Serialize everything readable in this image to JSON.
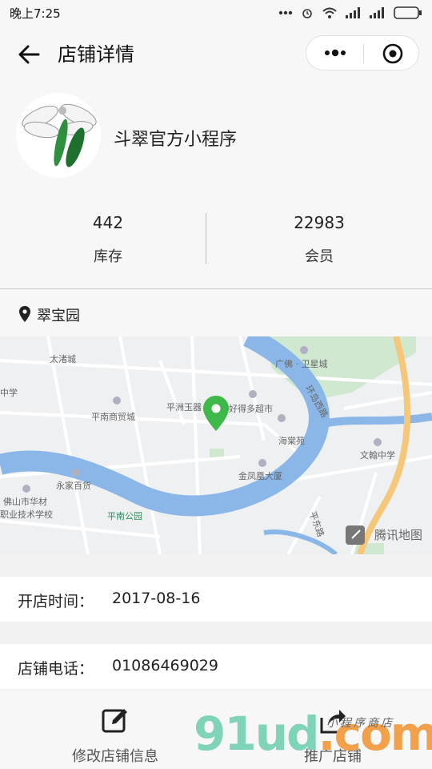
{
  "status_bar": {
    "time": "晚上7:25"
  },
  "nav": {
    "title": "店铺详情"
  },
  "store": {
    "name": "斗翠官方小程序"
  },
  "stats": [
    {
      "value": "442",
      "label": "库存"
    },
    {
      "value": "22983",
      "label": "会员"
    }
  ],
  "location": {
    "name": "翠宝园"
  },
  "map": {
    "labels": {
      "taiyan": "太渚城",
      "school": "中学",
      "pingnan_mall": "平南商贸城",
      "yongjia": "永家百货",
      "foshan_school_1": "佛山市华材",
      "foshan_school_2": "职业技术学校",
      "pingnan_park": "平南公园",
      "pingzhou": "平洲玉器",
      "haode": "好得多超市",
      "guangfo": "广佛 · 卫星城",
      "haitangyuan": "海棠苑",
      "jinfenghuang": "金凤凰大厦",
      "wenhan": "文翰中学",
      "huandao": "环岛西路",
      "pingdong": "平东路",
      "tencent_map": "腾讯地图"
    }
  },
  "info": [
    {
      "key": "开店时间：",
      "value": "2017-08-16"
    },
    {
      "key": "店铺电话：",
      "value": "01086469029"
    }
  ],
  "bottom": {
    "edit_label": "修改店铺信息",
    "promote_label": "推广店铺"
  },
  "watermark": {
    "main_g": "91ud",
    "main_com": ".com",
    "sub": "小程序商店"
  }
}
